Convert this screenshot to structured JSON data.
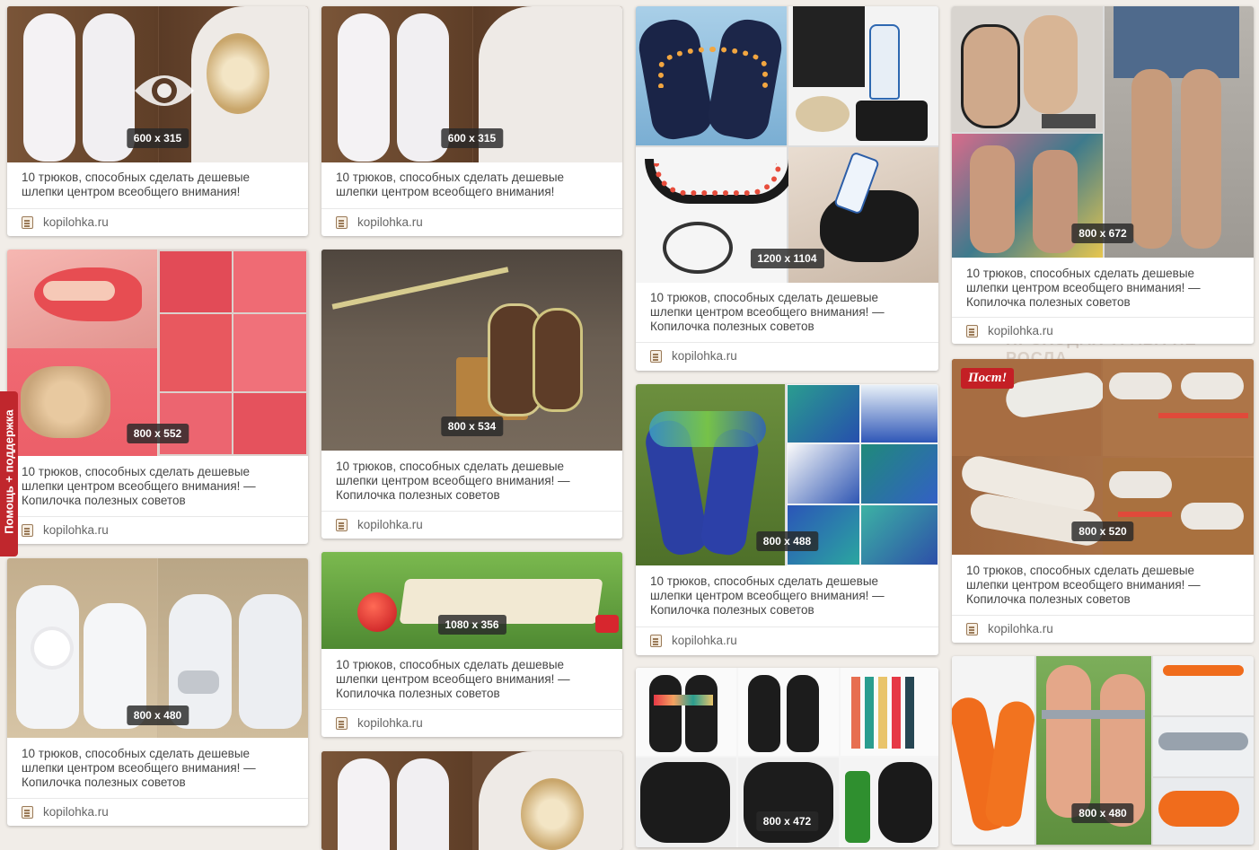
{
  "background_text": {
    "line1": "ПРОХОДАХ ТРАВА НЕ РОСЛА"
  },
  "help_tab": {
    "label": "Помощь + поддержка"
  },
  "cards": [
    {
      "dims": "600 x 315",
      "caption_line1": "10 трюков, способных сделать дешевые",
      "caption_line2": "шлепки центром всеобщего внимания!",
      "source": "kopilohka.ru"
    },
    {
      "dims": "600 x 315",
      "caption_line1": "10 трюков, способных сделать дешевые",
      "caption_line2": "шлепки центром всеобщего внимания!",
      "source": "kopilohka.ru"
    },
    {
      "dims": "1200 x 1104",
      "caption_line1": "10 трюков, способных сделать дешевые",
      "caption_line2": "шлепки центром всеобщего внимания! —",
      "caption_line3": "Копилочка полезных советов",
      "source": "kopilohka.ru"
    },
    {
      "dims": "800 x 672",
      "caption_line1": "10 трюков, способных сделать дешевые",
      "caption_line2": "шлепки центром всеобщего внимания! —",
      "caption_line3": "Копилочка полезных советов",
      "source": "kopilohka.ru"
    },
    {
      "dims": "800 x 552",
      "caption_line1": "10 трюков, способных сделать дешевые",
      "caption_line2": "шлепки центром всеобщего внимания! —",
      "caption_line3": "Копилочка полезных советов",
      "source": "kopilohka.ru"
    },
    {
      "dims": "800 x 534",
      "caption_line1": "10 трюков, способных сделать дешевые",
      "caption_line2": "шлепки центром всеобщего внимания! —",
      "caption_line3": "Копилочка полезных советов",
      "source": "kopilohka.ru"
    },
    {
      "dims": "800 x 488",
      "caption_line1": "10 трюков, способных сделать дешевые",
      "caption_line2": "шлепки центром всеобщего внимания! —",
      "caption_line3": "Копилочка полезных советов",
      "source": "kopilohka.ru"
    },
    {
      "dims": "800 x 520",
      "badge": "Пост!",
      "caption_line1": "10 трюков, способных сделать дешевые",
      "caption_line2": "шлепки центром всеобщего внимания! —",
      "caption_line3": "Копилочка полезных советов",
      "source": "kopilohka.ru"
    },
    {
      "dims": "800 x 480",
      "caption_line1": "10 трюков, способных сделать дешевые",
      "caption_line2": "шлепки центром всеобщего внимания! —",
      "caption_line3": "Копилочка полезных советов",
      "source": "kopilohka.ru"
    },
    {
      "dims": "1080 x 356",
      "caption_line1": "10 трюков, способных сделать дешевые",
      "caption_line2": "шлепки центром всеобщего внимания! —",
      "caption_line3": "Копилочка полезных советов",
      "source": "kopilohka.ru"
    },
    {
      "dims": "800 x 472"
    },
    {
      "dims": "800 x 480"
    },
    {
      "dims": ""
    }
  ]
}
